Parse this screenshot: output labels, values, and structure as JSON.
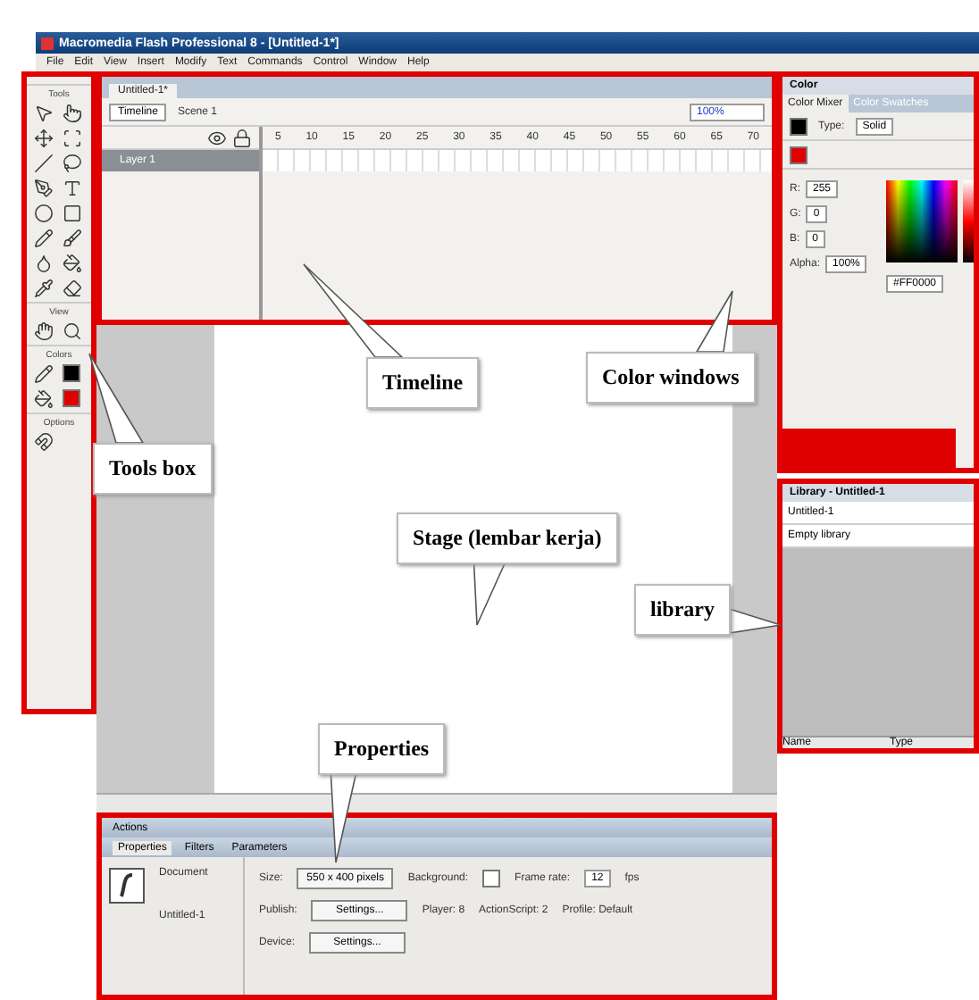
{
  "window": {
    "title": "Macromedia Flash Professional 8 - [Untitled-1*]"
  },
  "menu": [
    "File",
    "Edit",
    "View",
    "Insert",
    "Modify",
    "Text",
    "Commands",
    "Control",
    "Window",
    "Help"
  ],
  "tool_sections": [
    "Tools",
    "View",
    "Colors",
    "Options"
  ],
  "document_tabs": [
    {
      "label": "Untitled-1*",
      "selected": true
    }
  ],
  "timeline": {
    "button": "Timeline",
    "scene": "Scene 1",
    "zoom": "100%",
    "frame_numbers": [
      "5",
      "10",
      "15",
      "20",
      "25",
      "30",
      "35",
      "40",
      "45",
      "50",
      "55",
      "60",
      "65",
      "70"
    ],
    "layers": [
      {
        "name": "Layer 1",
        "selected": true
      }
    ]
  },
  "color_panel": {
    "title": "Color",
    "tabs": [
      {
        "label": "Color Mixer",
        "selected": true
      },
      {
        "label": "Color Swatches",
        "selected": false
      }
    ],
    "type_label": "Type:",
    "type_value": "Solid",
    "channels": [
      {
        "label": "R:",
        "value": "255"
      },
      {
        "label": "G:",
        "value": "0"
      },
      {
        "label": "B:",
        "value": "0"
      },
      {
        "label": "Alpha:",
        "value": "100%"
      }
    ],
    "hex": "#FF0000"
  },
  "library": {
    "title": "Library - Untitled-1",
    "document": "Untitled-1",
    "empty_text": "Empty library",
    "columns": [
      "Name",
      "Type"
    ]
  },
  "properties": {
    "actions": "Actions",
    "tabs": [
      {
        "label": "Properties",
        "selected": true
      },
      {
        "label": "Filters",
        "selected": false
      },
      {
        "label": "Parameters",
        "selected": false
      }
    ],
    "kind": "Document",
    "document": "Untitled-1",
    "size_label": "Size:",
    "size_value": "550 x 400 pixels",
    "background_label": "Background:",
    "frame_rate_label": "Frame rate:",
    "frame_rate": "12",
    "fps": "fps",
    "publish_label": "Publish:",
    "publish_button": "Settings...",
    "player": "Player: 8",
    "actionscript": "ActionScript: 2",
    "profile": "Profile: Default",
    "device_label": "Device:",
    "device_button": "Settings..."
  },
  "annotations": [
    "Timeline",
    "Color windows",
    "Tools box",
    "Stage (lembar kerja)",
    "library",
    "Properties"
  ]
}
